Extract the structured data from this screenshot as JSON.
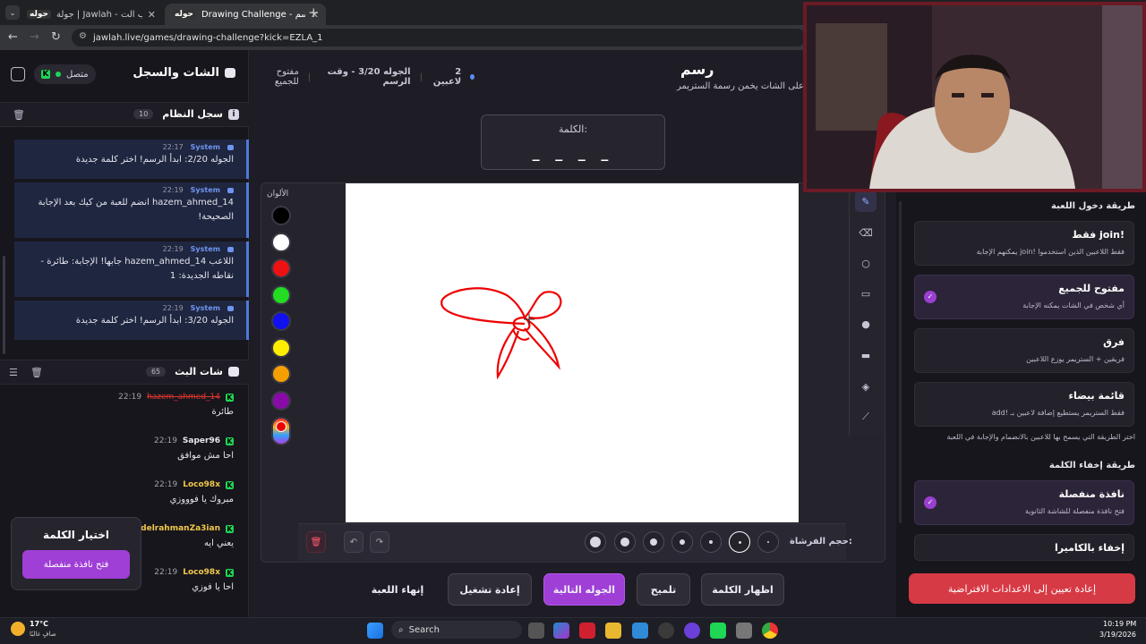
{
  "browser": {
    "tab1_title": "جولة | Jawlah - منصة الألعاب الت",
    "tab1_badge": "حوله",
    "tab2_title": "Drawing Challenge - تحدي الرسم",
    "tab2_badge": "حوله",
    "url": "jawlah.live/games/drawing-challenge?kick=EZLA_1"
  },
  "sidebar": {
    "title": "الشات والسجل",
    "status": "متصل",
    "system_log_title": "سجل النظام",
    "system_log_count": "10",
    "system_messages": [
      {
        "name": "System",
        "time": "22:17",
        "text": "الجوله 2/20: ابدأ الرسم! اختر كلمة جديدة"
      },
      {
        "name": "System",
        "time": "22:19",
        "text": "hazem_ahmed_14 انضم للعبة من كيك بعد الإجابة الصحيحة!"
      },
      {
        "name": "System",
        "time": "22:19",
        "text": "اللاعب hazem_ahmed_14 جابها! الإجابة: طائرة - نقاطه الجديدة: 1"
      },
      {
        "name": "System",
        "time": "22:19",
        "text": "الجوله 3/20: ابدأ الرسم! اختر كلمة جديدة"
      }
    ],
    "stream_chat_title": "شات البث",
    "stream_chat_count": "65",
    "chat": [
      {
        "user": "hazem_ahmed_14",
        "time": "22:19",
        "text": "طائرة",
        "color": "#e0362f"
      },
      {
        "user": "Saper96",
        "time": "22:19",
        "text": "احا مش موافق",
        "color": "#e8e6f0"
      },
      {
        "user": "Loco98x",
        "time": "22:19",
        "text": "مبروك يا فوووزي",
        "color": "#f2c84b"
      },
      {
        "user": "abdelrahmanZa3ian",
        "time": "",
        "text": "يعني ايه",
        "color": "#f2c84b"
      },
      {
        "user": "Loco98x",
        "time": "22:19",
        "text": "احا يا فوزي",
        "color": "#f2c84b"
      }
    ],
    "popup_title": "اختيار الكلمة",
    "popup_button": "فتح نافذة منفصلة"
  },
  "game": {
    "title": "رسم",
    "subtitle": "على الشات يخمن رسمة الستريمر",
    "players": "2 لاعبين",
    "round": "الجوله 3/20 - وقت الرسم",
    "mode": "مفتوح للجميع",
    "word_label": "الكلمة:",
    "word_value": "_ _ _ _",
    "colors_label": "الألوان",
    "colors": [
      "#000000",
      "#ffffff",
      "#ee1111",
      "#22dd22",
      "#1111ee",
      "#ffee00",
      "#f5a000",
      "#8a0aa8"
    ],
    "brush_size_label": "حجم الفرشاة:",
    "buttons": {
      "show_word": "اظهار الكلمة",
      "hint": "تلميح",
      "next_round": "الجوله التالية",
      "restart": "إعادة تشغيل",
      "end_game": "إنهاء اللعبة"
    }
  },
  "right_panel": {
    "join_section": "طريقة دخول اللعبة",
    "options": [
      {
        "title": "!join فقط",
        "desc": "فقط اللاعبين الذين استخدموا !join يمكنهم الإجابة",
        "selected": false
      },
      {
        "title": "مفتوح للجميع",
        "desc": "أي شخص في الشات يمكنه الإجابة",
        "selected": true
      },
      {
        "title": "فرق",
        "desc": "فريقين + الستريمر يوزع اللاعبين",
        "selected": false
      },
      {
        "title": "قائمة بيضاء",
        "desc": "فقط الستريمر يستطيع إضافة لاعبين بـ !add",
        "selected": false
      }
    ],
    "join_hint": "اختر الطريقة التي يسمح بها للاعبين بالانضمام والإجابة في اللعبة",
    "hide_section": "طريقة إخفاء الكلمة",
    "hide_options": [
      {
        "title": "نافذة منفصلة",
        "desc": "فتح نافذة منفصلة للشاشة الثانوية",
        "selected": true
      },
      {
        "title": "إخفاء بالكاميرا",
        "desc": "",
        "selected": false
      }
    ],
    "reset_button": "إعادة تعيين إلى الاعدادات الافتراضية"
  },
  "taskbar": {
    "weather_temp": "17°C",
    "weather_text": "صافٍ غالبًا",
    "search": "Search",
    "time": "10:19 PM",
    "date": "3/19/2026"
  }
}
